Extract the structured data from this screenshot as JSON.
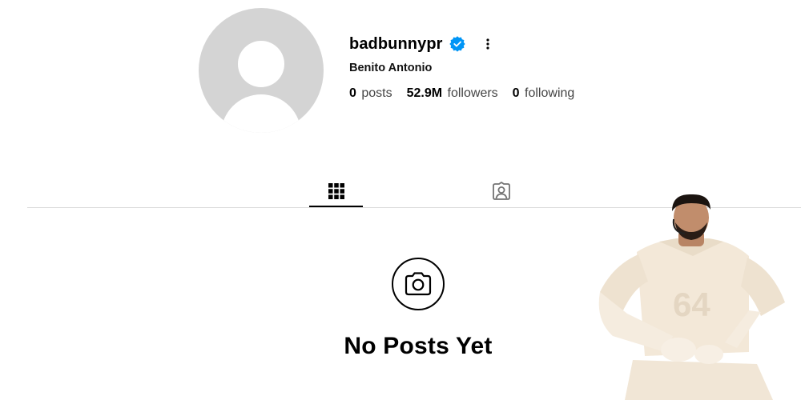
{
  "profile": {
    "username": "badbunnypr",
    "full_name": "Benito Antonio",
    "verified": true,
    "verified_badge_icon": "verified-badge-icon",
    "more_options_icon": "more-dots-icon",
    "avatar_icon": "default-avatar-icon"
  },
  "stats": [
    {
      "value": "0",
      "label": "posts"
    },
    {
      "value": "52.9M",
      "label": "followers"
    },
    {
      "value": "0",
      "label": "following"
    }
  ],
  "tabs": [
    {
      "id": "posts",
      "icon": "grid-icon",
      "active": true
    },
    {
      "id": "tagged",
      "icon": "tagged-person-icon",
      "active": false
    }
  ],
  "empty_state": {
    "icon": "camera-icon",
    "title": "No Posts Yet"
  },
  "overlay": {
    "figure": "person-cutout-figure"
  },
  "colors": {
    "verified_blue": "#0095f6",
    "avatar_gray": "#d4d4d4",
    "divider": "#dbdbdb",
    "outfit_cream": "#f3e8d8"
  }
}
